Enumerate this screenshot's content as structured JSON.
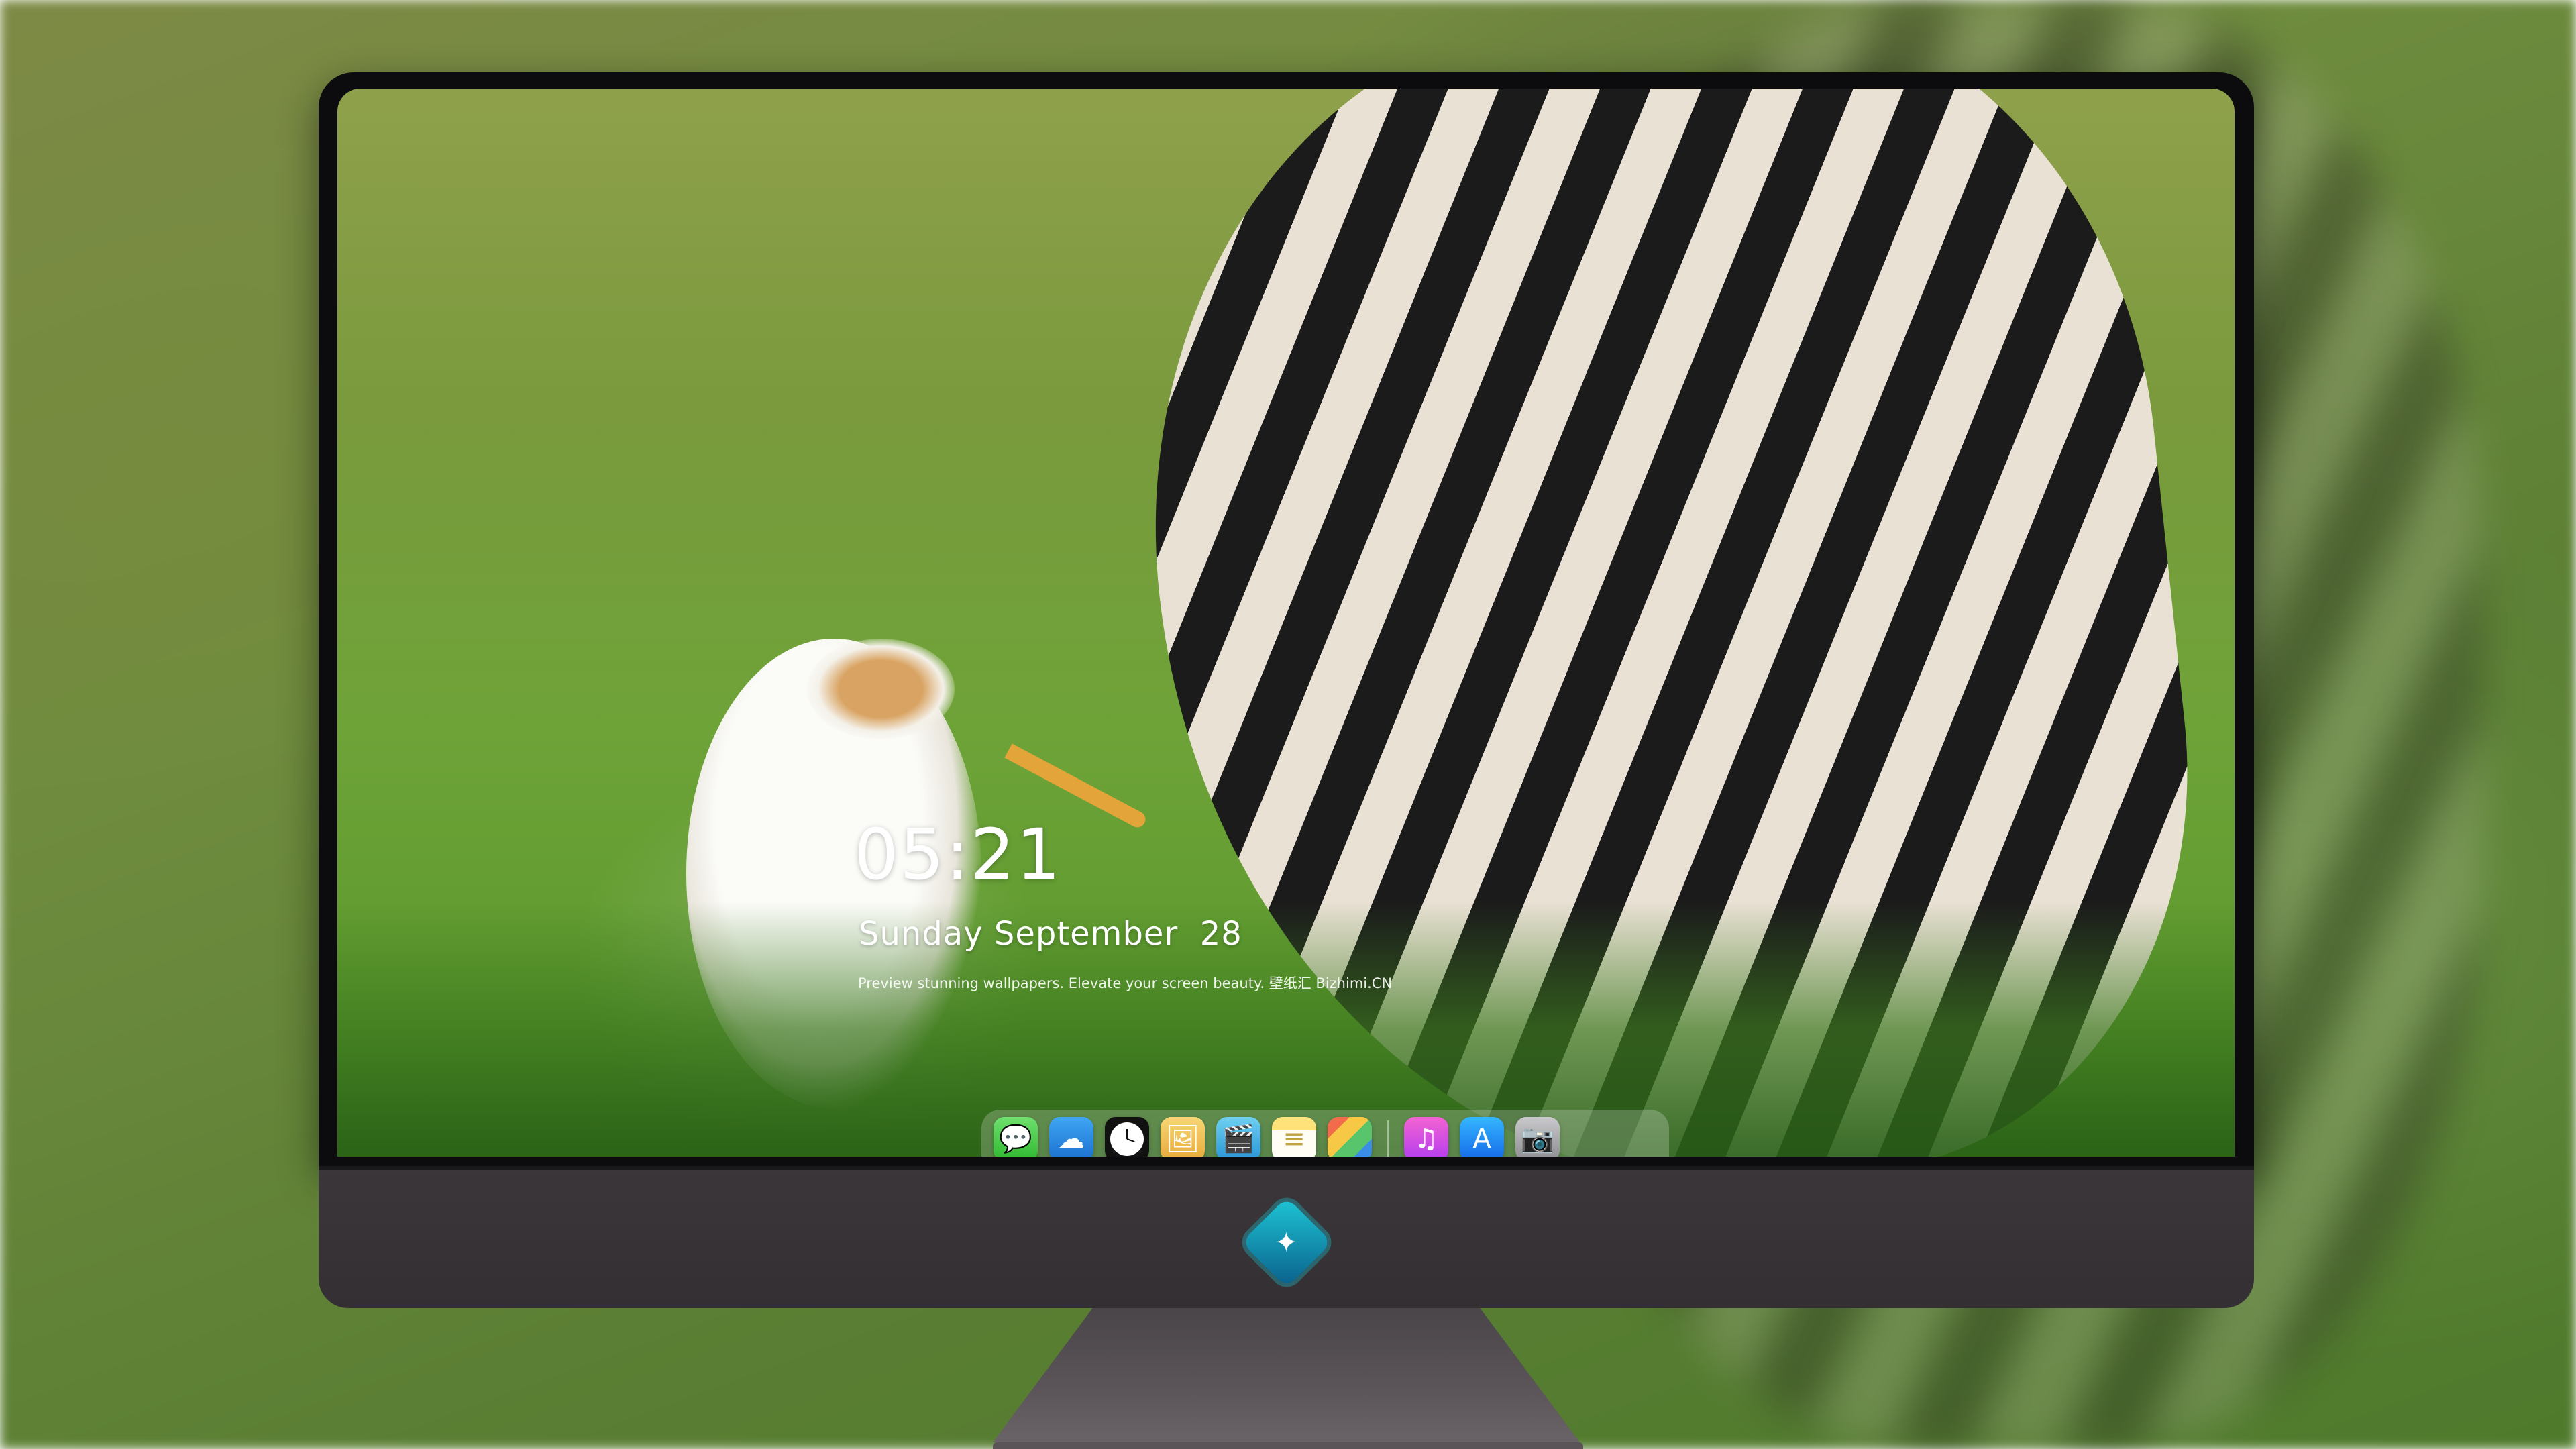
{
  "lock_screen": {
    "time": "05:21",
    "date": "Sunday September  28",
    "tagline": "Preview stunning wallpapers. Elevate your screen beauty. 壁纸汇 Bizhimi.CN"
  },
  "dock": {
    "apps": [
      {
        "name": "Messages",
        "icon": "messages-icon",
        "glyph": "💬"
      },
      {
        "name": "Weather",
        "icon": "weather-icon",
        "glyph": "☁"
      },
      {
        "name": "Clock",
        "icon": "clock-icon",
        "glyph": ""
      },
      {
        "name": "Preview",
        "icon": "preview-icon",
        "glyph": "🖼"
      },
      {
        "name": "Clips",
        "icon": "clips-icon",
        "glyph": "🎬"
      },
      {
        "name": "Notes",
        "icon": "notes-icon",
        "glyph": "≡"
      },
      {
        "name": "Photo Booth",
        "icon": "photos-icon",
        "glyph": ""
      },
      {
        "name": "Music",
        "icon": "music-icon",
        "glyph": "♫"
      },
      {
        "name": "App Store",
        "icon": "appstore-icon",
        "glyph": "A"
      },
      {
        "name": "Camera",
        "icon": "camera-icon",
        "glyph": "📷"
      }
    ]
  },
  "chin": {
    "logo": "brand-logo-icon",
    "logo_glyph": "✦"
  },
  "colors": {
    "bezel": "#0c0c0e",
    "chin": "#3a3639",
    "accent_logo": "#1ec6d6"
  }
}
